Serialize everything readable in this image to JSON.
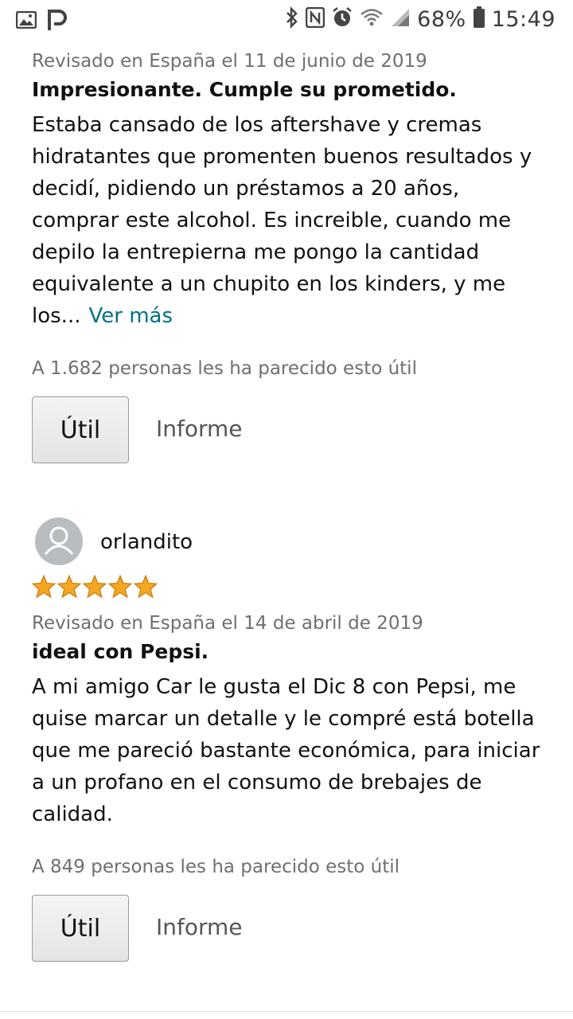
{
  "status_bar": {
    "battery": "68%",
    "time": "15:49",
    "icons": [
      "image-icon",
      "app-p-icon",
      "bluetooth-icon",
      "nfc-icon",
      "alarm-icon",
      "wifi-icon",
      "signal-icon",
      "battery-icon"
    ]
  },
  "reviews": [
    {
      "meta": "Revisado en España el 11 de junio de 2019",
      "title": "Impresionante. Cumple su prometido.",
      "lines": [
        "Estaba cansado de los aftershave y cremas",
        "hidratantes que promenten buenos resultados y",
        "decidí, pidiendo un préstamos a 20 años,",
        "comprar este alcohol. Es increible, cuando me",
        "depilo la entrepierna me pongo la cantidad",
        "equivalente a un chupito en los kinders, y me",
        "los..."
      ],
      "more_label": "Ver más",
      "helpful_text": "A 1.682 personas les ha parecido esto útil",
      "helpful_button": "Útil",
      "report_link": "Informe"
    },
    {
      "author": "orlandito",
      "rating": 5,
      "meta": "Revisado en España el 14 de abril de 2019",
      "title": "ideal con Pepsi.",
      "lines": [
        "A mi amigo Car le gusta el Dic 8 con Pepsi, me",
        "quise marcar un detalle y le compré está botella",
        "que me pareció bastante económica, para iniciar",
        "a un profano en el consumo de brebajes de",
        "calidad."
      ],
      "helpful_text": "A 849 personas les ha parecido esto útil",
      "helpful_button": "Útil",
      "report_link": "Informe"
    }
  ],
  "colors": {
    "link": "#007185",
    "star": "#f5a623",
    "meta": "#6f6f6f"
  }
}
